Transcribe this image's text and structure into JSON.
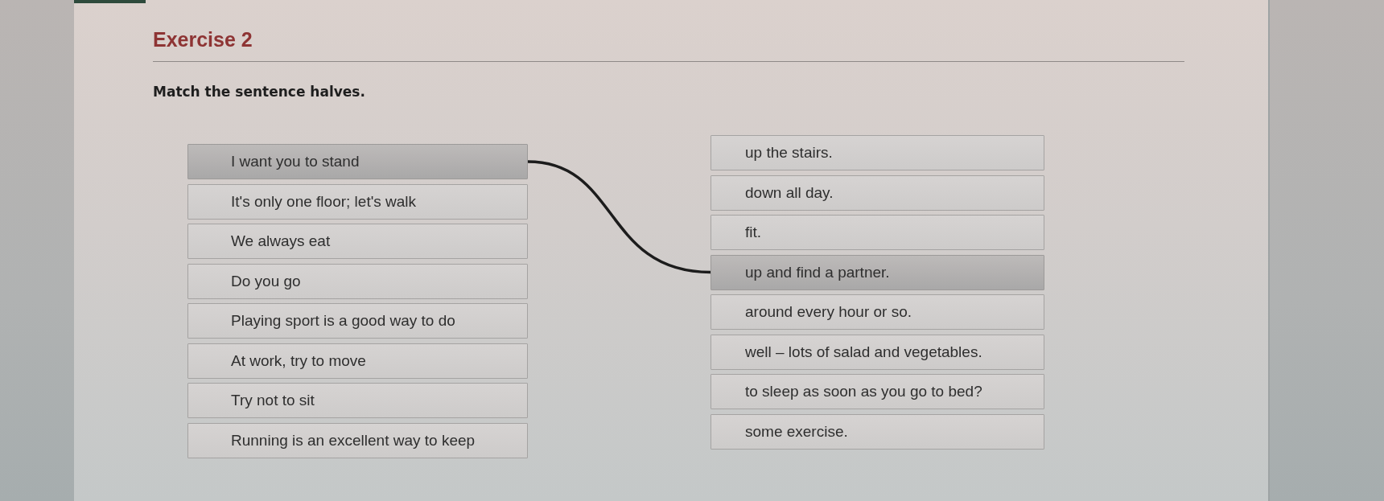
{
  "title": "Exercise 2",
  "instruction": "Match the sentence halves.",
  "left_items": [
    {
      "text": "I want you to stand",
      "matched": true
    },
    {
      "text": "It's only one floor; let's walk",
      "matched": false
    },
    {
      "text": "We always eat",
      "matched": false
    },
    {
      "text": "Do you go",
      "matched": false
    },
    {
      "text": "Playing sport is a good way to do",
      "matched": false
    },
    {
      "text": "At work, try to move",
      "matched": false
    },
    {
      "text": "Try not to sit",
      "matched": false
    },
    {
      "text": "Running is an excellent way to keep",
      "matched": false
    }
  ],
  "right_items": [
    {
      "text": "up the stairs.",
      "matched": false
    },
    {
      "text": "down all day.",
      "matched": false
    },
    {
      "text": "fit.",
      "matched": false
    },
    {
      "text": "up and find a partner.",
      "matched": true
    },
    {
      "text": "around every hour or so.",
      "matched": false
    },
    {
      "text": "well – lots of salad and vegetables.",
      "matched": false
    },
    {
      "text": "to sleep as soon as you go to bed?",
      "matched": false
    },
    {
      "text": "some exercise.",
      "matched": false
    }
  ]
}
